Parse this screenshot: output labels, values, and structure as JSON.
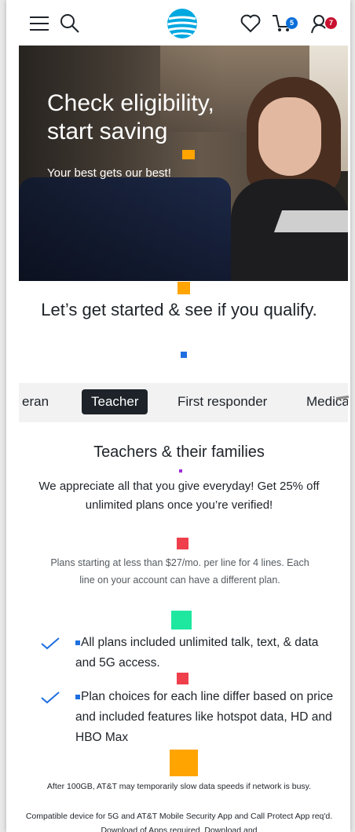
{
  "header": {
    "menu_icon": "hamburger-menu-icon",
    "search_icon": "search-icon",
    "logo_icon": "att-globe-logo",
    "wishlist_icon": "heart-icon",
    "cart_icon": "shopping-cart-icon",
    "cart_count": "5",
    "account_icon": "user-icon",
    "account_count": "7",
    "brand_color": "#00a8e0"
  },
  "hero": {
    "title": "Check eligibility, start saving",
    "subtitle": "Your best gets our best!"
  },
  "heading": "Let’s get started & see if you qualify.",
  "tabs": [
    {
      "label": "eran",
      "active": false
    },
    {
      "label": "Teacher",
      "active": true
    },
    {
      "label": "First responder",
      "active": false
    },
    {
      "label": "Medica",
      "active": false
    }
  ],
  "section": {
    "title": "Teachers & their families",
    "body": "We appreciate all that you give everyday! Get 25% off unlimited plans once you’re verified!",
    "plans": "Plans starting at less than $27/mo. per line for 4 lines.  Each line on your account can have a different plan.",
    "features": [
      "All plans included unlimited talk, text, & data and 5G access.",
      "Plan choices for each line differ based on price and included features like hotspot data, HD and HBO Max"
    ],
    "fine_print": [
      "After 100GB,  AT&T may temporarily slow data speeds if network is busy.",
      "Compatible device for 5G and AT&T Mobile Security App and Call Protect App req'd. Download of Apps required. Download and"
    ]
  },
  "colors": {
    "dark": "#1d2329",
    "badge_blue": "#0a6fd8",
    "badge_red": "#c8102e",
    "marker_orange": "#ffa400",
    "marker_blue": "#1f6fe0",
    "marker_red": "#ee3f4b",
    "marker_teal": "#1ee8a0",
    "marker_purple": "#a02ad8"
  }
}
